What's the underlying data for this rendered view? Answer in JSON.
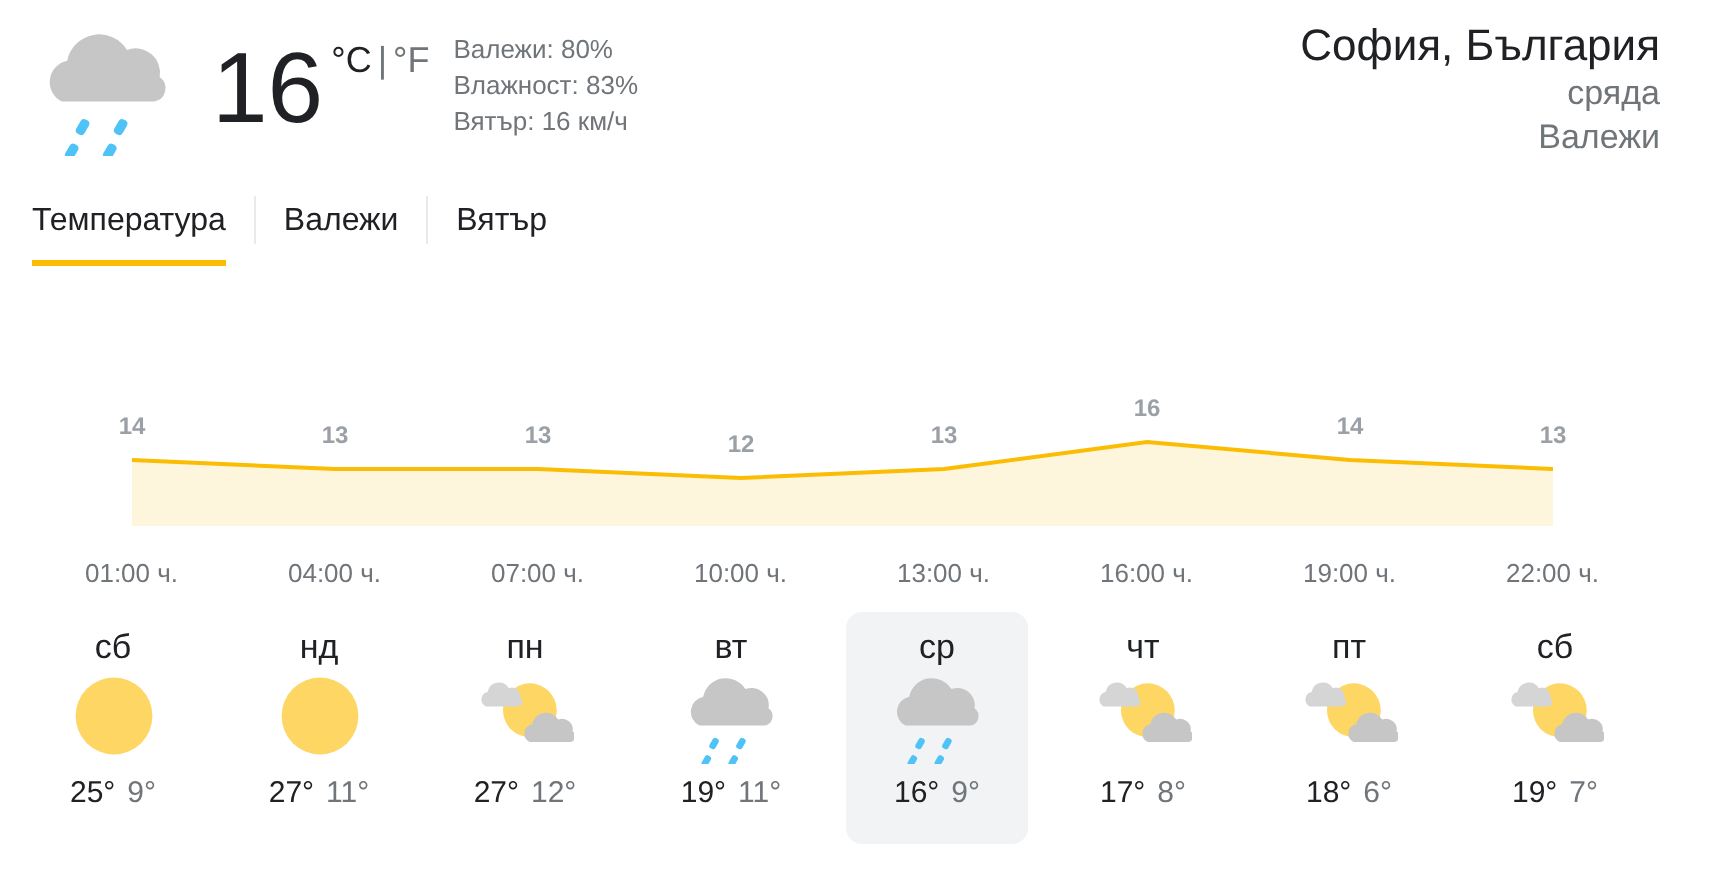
{
  "current": {
    "kind": "rain",
    "temperature": "16",
    "unit_c": "°C",
    "unit_sep": "|",
    "unit_f": "°F",
    "details": [
      "Валежи: 80%",
      "Влажност: 83%",
      "Вятър: 16 км/ч"
    ]
  },
  "location": {
    "place": "София, България",
    "day": "сряда",
    "condition": "Валежи"
  },
  "tabs": [
    {
      "label": "Температура",
      "selected": true
    },
    {
      "label": "Валежи",
      "selected": false
    },
    {
      "label": "Вятър",
      "selected": false
    }
  ],
  "chart_data": {
    "type": "area",
    "categories": [
      "01:00 ч.",
      "04:00 ч.",
      "07:00 ч.",
      "10:00 ч.",
      "13:00 ч.",
      "16:00 ч.",
      "19:00 ч.",
      "22:00 ч."
    ],
    "series": [
      {
        "color": "#fbbc04",
        "values": [
          14,
          13,
          13,
          12,
          13,
          16,
          14,
          13
        ]
      }
    ],
    "data_labels": true
  },
  "days": [
    {
      "day": "сб",
      "kind": "sunny",
      "high": "25°",
      "low": "9°",
      "selected": false
    },
    {
      "day": "нд",
      "kind": "sunny",
      "high": "27°",
      "low": "11°",
      "selected": false
    },
    {
      "day": "пн",
      "kind": "partly-cloudy",
      "high": "27°",
      "low": "12°",
      "selected": false
    },
    {
      "day": "вт",
      "kind": "rain",
      "high": "19°",
      "low": "11°",
      "selected": false
    },
    {
      "day": "ср",
      "kind": "rain",
      "high": "16°",
      "low": "9°",
      "selected": true
    },
    {
      "day": "чт",
      "kind": "partly-cloudy",
      "high": "17°",
      "low": "8°",
      "selected": false
    },
    {
      "day": "пт",
      "kind": "partly-cloudy",
      "high": "18°",
      "low": "6°",
      "selected": false
    },
    {
      "day": "сб",
      "kind": "partly-cloudy",
      "high": "19°",
      "low": "7°",
      "selected": false
    }
  ]
}
